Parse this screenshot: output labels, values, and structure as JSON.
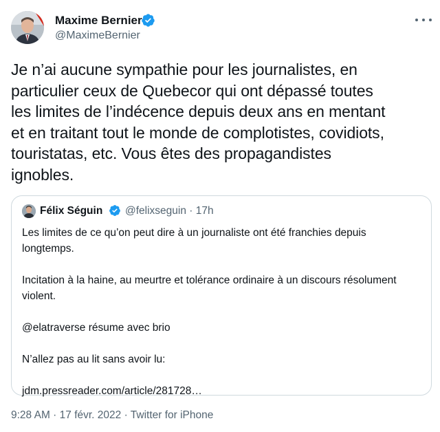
{
  "author": {
    "name": "Maxime Bernier",
    "handle": "@MaximeBernier"
  },
  "tweet": {
    "text": "Je n’ai aucune sympathie pour les journalistes, en\nparticulier ceux de Quebecor qui ont dépassé toutes\nles limites de l’indécence depuis deux ans en mentant\net en traitant tout le monde de complotistes, covidiots,\ntouristatas, etc. Vous êtes des propagandistes\nignobles."
  },
  "quoted": {
    "name": "Félix Séguin",
    "handle_time": "@felixseguin · 17h",
    "paragraphs": [
      "Les limites de ce qu’on peut dire à un journaliste ont été franchies depuis longtemps.",
      "Incitation à la haine, au meurtre et tolérance ordinaire à un discours résolument violent.",
      "@elatraverse résume avec brio",
      "N’allez pas au lit sans avoir lu:",
      "jdm.pressreader.com/article/281728…"
    ]
  },
  "footer": {
    "meta": "9:28 AM · 17 févr. 2022 · Twitter for iPhone"
  },
  "icons": {
    "verified": "verified-badge-icon",
    "more": "more-horizontal-icon"
  },
  "colors": {
    "verified_blue": "#1d9bf0",
    "secondary_text": "#536471",
    "border": "#cfd9de"
  }
}
